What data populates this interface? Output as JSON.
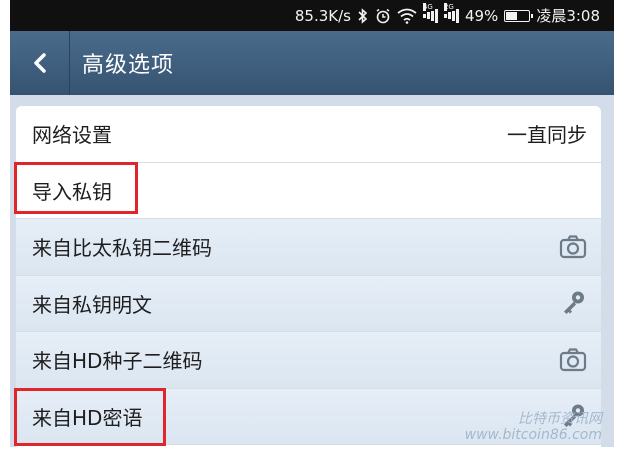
{
  "status_bar": {
    "speed": "85.3K/s",
    "bluetooth_icon": "bluetooth-icon",
    "alarm_icon": "alarm-icon",
    "wifi_icon": "wifi-icon",
    "signal1_tag": "4G",
    "signal2_tag": "2G",
    "battery_percent": "49%",
    "battery_level": 0.49,
    "time": "凌晨3:08"
  },
  "header": {
    "back_icon": "chevron-left-icon",
    "title": "高级选项"
  },
  "rows": [
    {
      "label": "网络设置",
      "value": "一直同步"
    },
    {
      "label": "导入私钥"
    },
    {
      "label": "来自比太私钥二维码",
      "icon": "camera-icon"
    },
    {
      "label": "来自私钥明文",
      "icon": "key-icon"
    },
    {
      "label": "来自HD种子二维码",
      "icon": "camera-icon"
    },
    {
      "label": "来自HD密语",
      "icon": "key-icon"
    }
  ],
  "watermark": {
    "line1": "比特币资讯网",
    "line2": "www.bitcoin86.com"
  },
  "colors": {
    "header": "#3f5e7e",
    "highlight": "#e0262b",
    "sub_row": "#e0e9f3"
  }
}
